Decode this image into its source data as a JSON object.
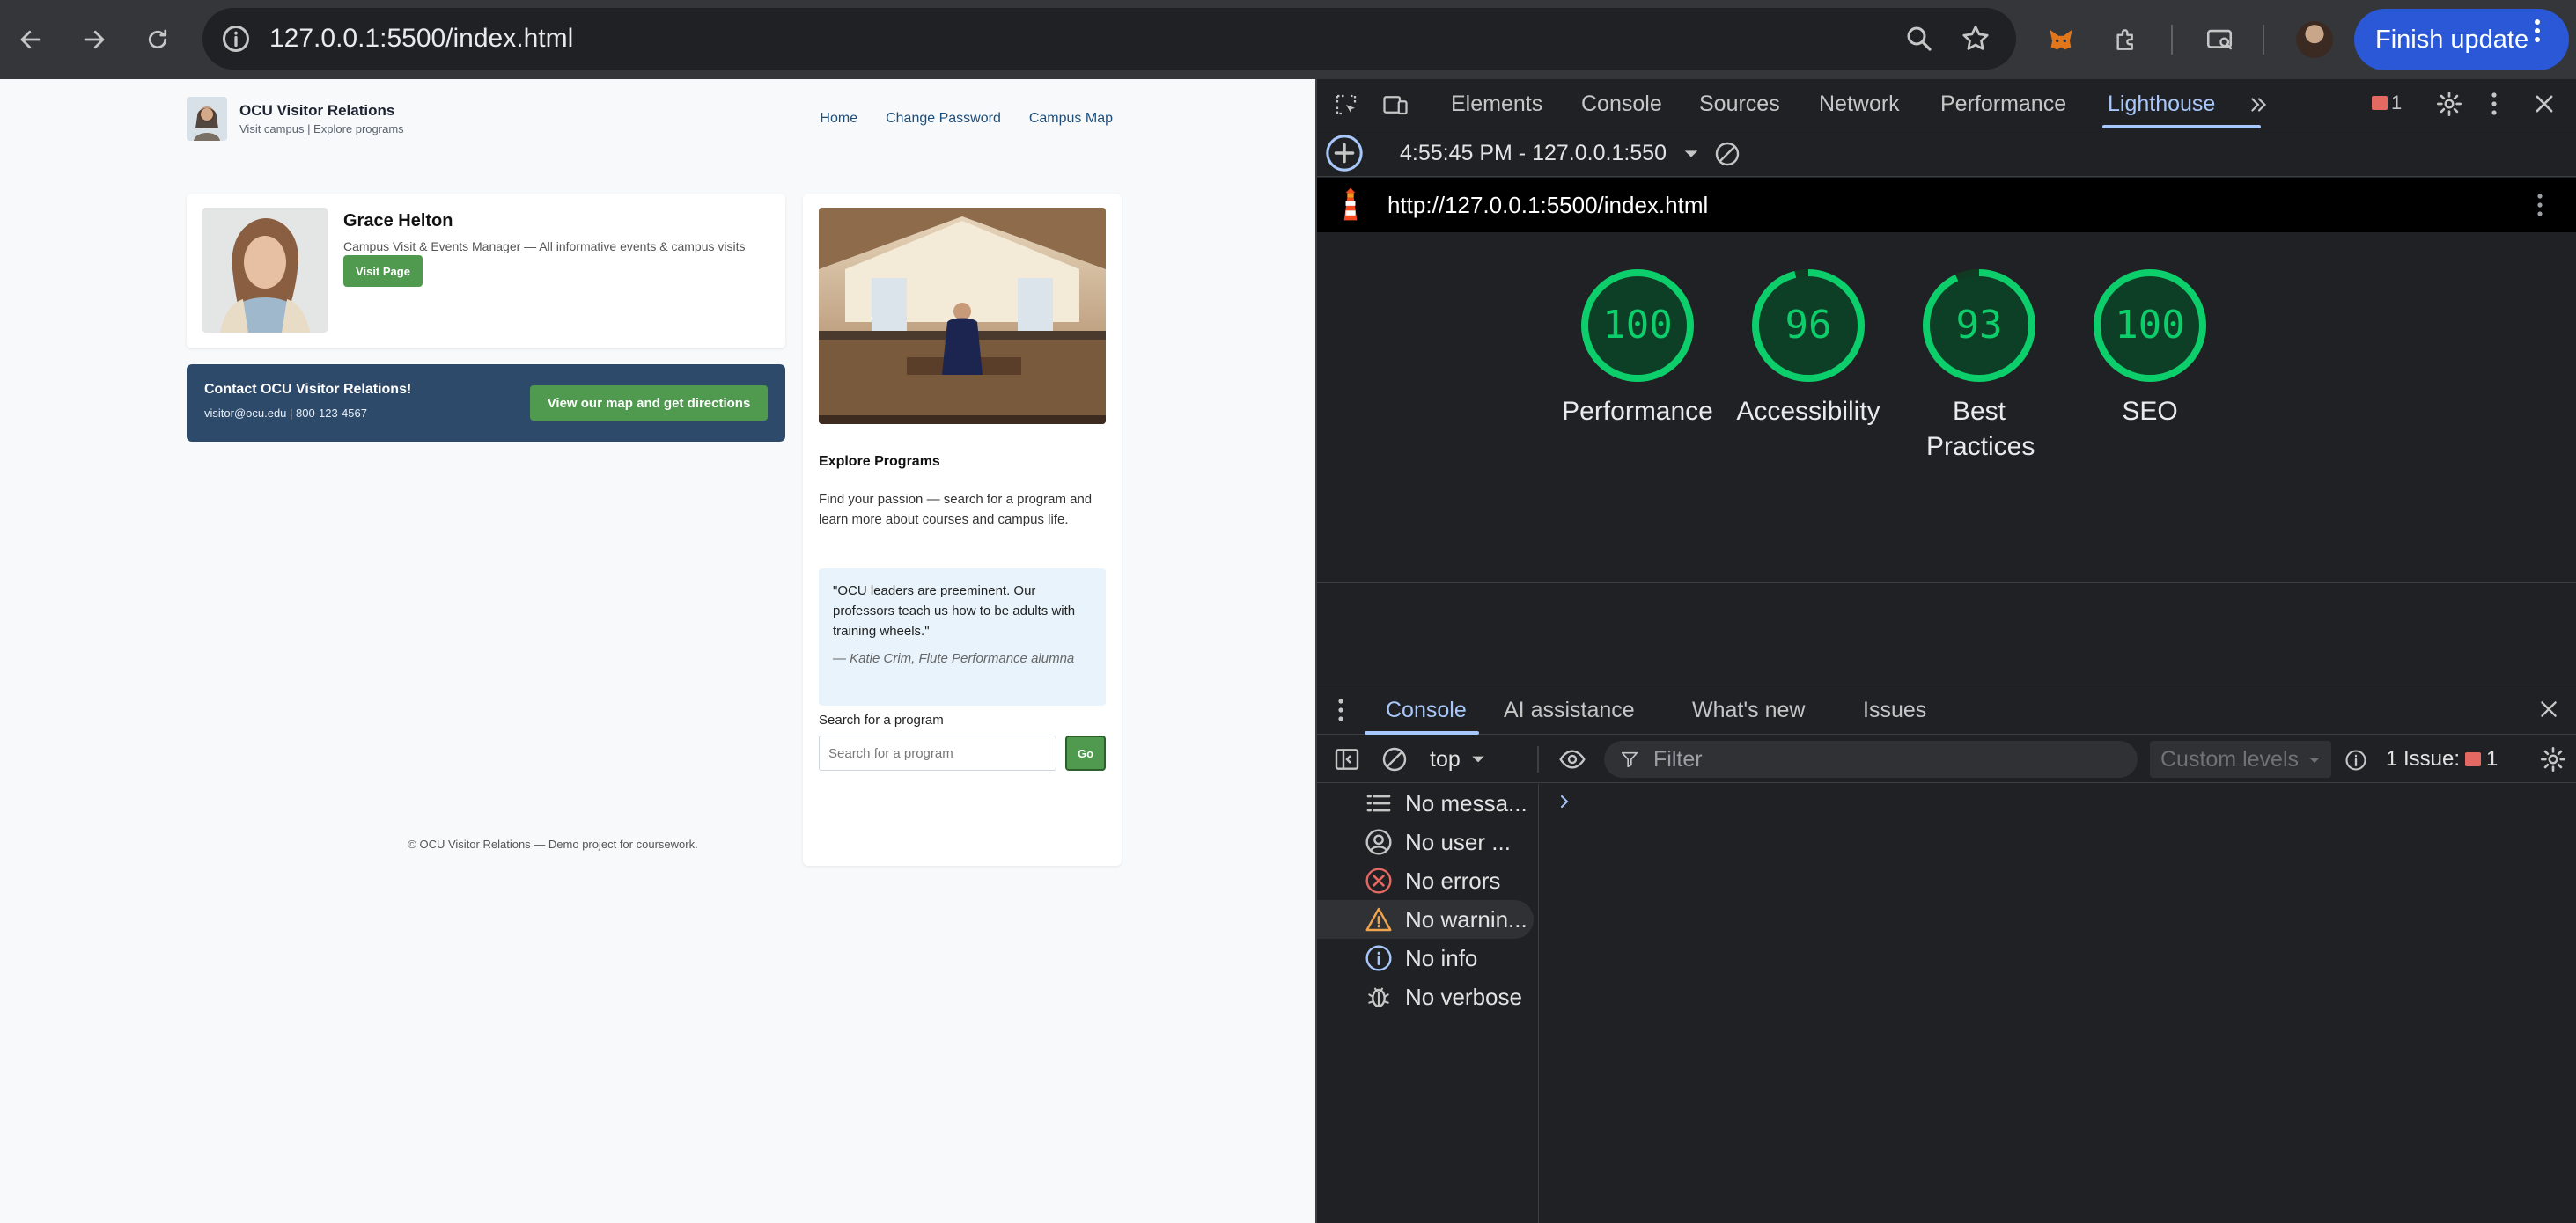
{
  "browser": {
    "url": "127.0.0.1:5500/index.html",
    "finish_update_label": "Finish update",
    "accent": "#2a58d6"
  },
  "site": {
    "brand_title": "OCU Visitor Relations",
    "brand_subtitle": "Visit campus | Explore programs",
    "nav": [
      "Home",
      "Change Password",
      "Campus Map"
    ],
    "profile": {
      "name": "Grace Helton",
      "role": "Campus Visit & Events Manager — All informative events & campus visits",
      "button_label": "Visit Page"
    },
    "contact": {
      "title": "Contact OCU Visitor Relations!",
      "info": "visitor@ocu.edu | 800-123-4567",
      "button_label": "View our map and get directions"
    },
    "programs": {
      "title": "Explore Programs",
      "description": "Find your passion — search for a program and learn more about courses and campus life.",
      "quote": "\"OCU leaders are preeminent. Our professors teach us how to be adults with training wheels.\"",
      "quote_author": "— Katie Crim, Flute Performance alumna",
      "search_label": "Search for a program",
      "search_placeholder": "Search for a program",
      "go_label": "Go"
    },
    "footer": "© OCU Visitor Relations — Demo project for coursework.",
    "colors": {
      "primary_button": "#4f9a4f",
      "contact_banner": "#2d4a6b",
      "link": "#1f4e79"
    }
  },
  "devtools": {
    "tabs": [
      "Elements",
      "Console",
      "Sources",
      "Network",
      "Performance",
      "Lighthouse"
    ],
    "active_tab": "Lighthouse",
    "issue_badge_count": "1",
    "lighthouse": {
      "report_time": "4:55:45 PM - 127.0.0.1:550",
      "report_url": "http://127.0.0.1:5500/index.html",
      "scores": [
        {
          "label": "Performance",
          "value": 100
        },
        {
          "label": "Accessibility",
          "value": 96
        },
        {
          "label": "Best Practices",
          "value": 93
        },
        {
          "label": "SEO",
          "value": 100
        }
      ],
      "score_color": "#0cce6b"
    },
    "drawer": {
      "tabs": [
        "Console",
        "AI assistance",
        "What's new",
        "Issues"
      ],
      "active_tab": "Console",
      "context": "top",
      "filter_placeholder": "Filter",
      "levels_label": "Custom levels",
      "issues_label": "1 Issue:",
      "issues_count": "1",
      "sidebar": [
        {
          "label": "No messa...",
          "icon": "list-icon"
        },
        {
          "label": "No user ...",
          "icon": "user-icon"
        },
        {
          "label": "No errors",
          "icon": "error-icon"
        },
        {
          "label": "No warnin...",
          "icon": "warning-icon"
        },
        {
          "label": "No info",
          "icon": "info-icon"
        },
        {
          "label": "No verbose",
          "icon": "bug-icon"
        }
      ]
    }
  }
}
